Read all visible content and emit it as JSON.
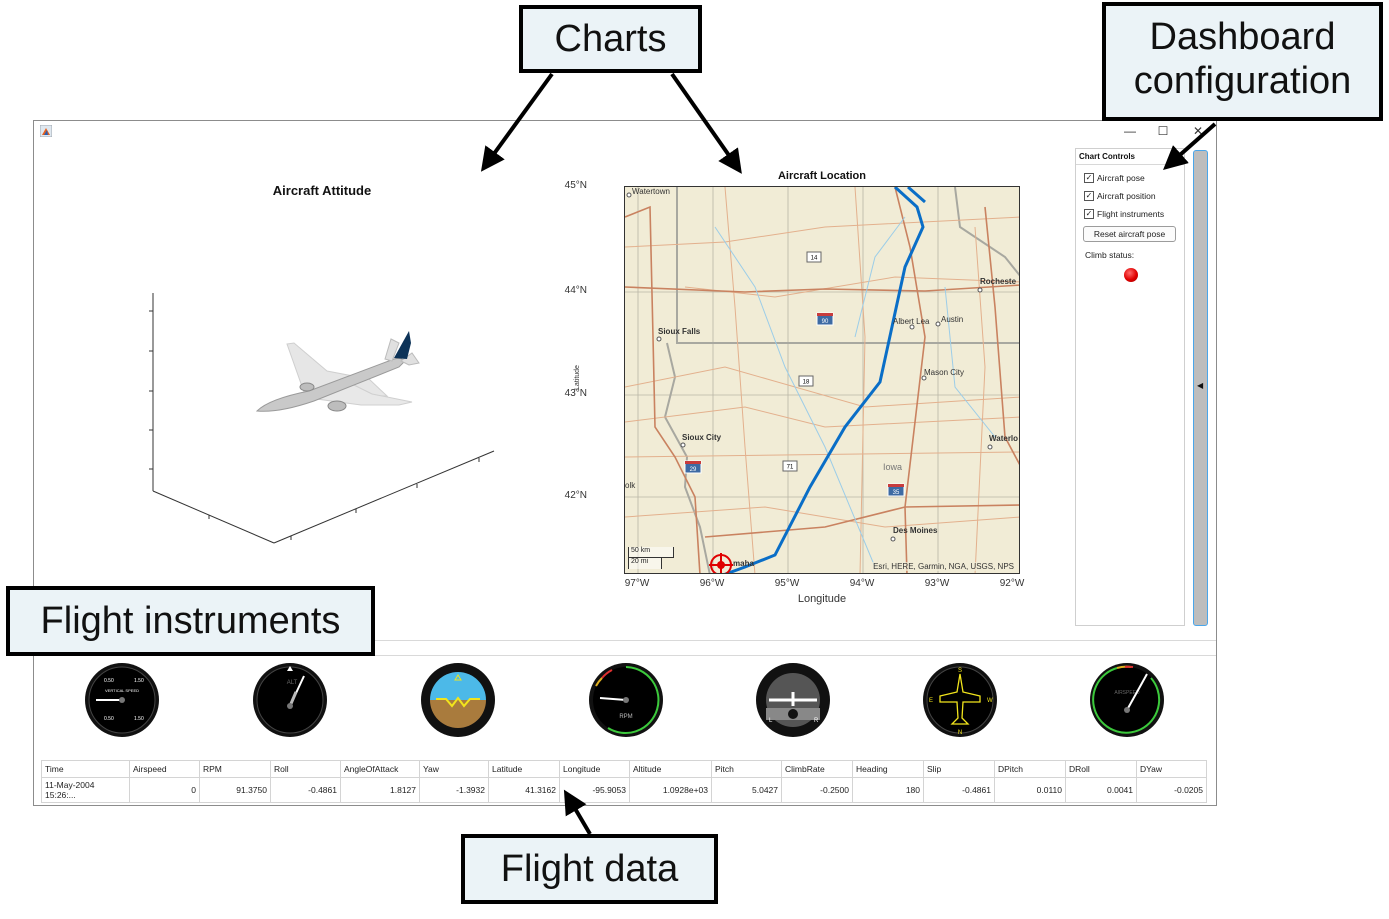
{
  "window": {
    "minimize_glyph": "—",
    "maximize_glyph": "☐",
    "close_glyph": "✕"
  },
  "attitude_chart": {
    "title": "Aircraft Attitude",
    "tail_color": "#0d3358",
    "body_color": "#d8d8d8"
  },
  "map_chart": {
    "title": "Aircraft Location",
    "xlabel": "Longitude",
    "ylabel": "Latitude",
    "lat_ticks": [
      "45°N",
      "44°N",
      "43°N",
      "42°N"
    ],
    "lon_ticks": [
      "97°W",
      "96°W",
      "95°W",
      "94°W",
      "93°W",
      "92°W"
    ],
    "attribution": "Esri, HERE, Garmin, NGA, USGS, NPS",
    "scale_km": "50 km",
    "scale_mi": "20 mi",
    "cities": [
      {
        "name": "Watertown",
        "bold": false
      },
      {
        "name": "Sioux Falls",
        "bold": true
      },
      {
        "name": "Sioux City",
        "bold": true
      },
      {
        "name": "Albert Lea",
        "bold": false
      },
      {
        "name": "Austin",
        "bold": false
      },
      {
        "name": "Rocheste",
        "bold": true
      },
      {
        "name": "Mason City",
        "bold": false
      },
      {
        "name": "Waterlo",
        "bold": true
      },
      {
        "name": "Iowa",
        "bold": false
      },
      {
        "name": "Des Moines",
        "bold": true
      },
      {
        "name": "maha",
        "bold": true
      },
      {
        "name": "olk",
        "bold": false
      }
    ],
    "route_shields": [
      "14",
      "90",
      "18",
      "71",
      "29",
      "35"
    ],
    "track_color": "#0a6ec7",
    "marker_color": "#e00000",
    "current_position": {
      "lat": 41.3162,
      "lon": -95.9053
    }
  },
  "chart_controls": {
    "title": "Chart Controls",
    "checkboxes": [
      {
        "label": "Aircraft pose",
        "checked": true
      },
      {
        "label": "Aircraft position",
        "checked": true
      },
      {
        "label": "Flight instruments",
        "checked": true
      }
    ],
    "reset_button": "Reset aircraft pose",
    "climb_status_label": "Climb status:",
    "climb_status_color": "#e00000",
    "collapse_glyph": "◀"
  },
  "instruments": [
    {
      "name": "Vertical speed indicator",
      "label": "VERTICAL SPEED"
    },
    {
      "name": "Altimeter",
      "label": "ALT"
    },
    {
      "name": "Artificial horizon",
      "label": ""
    },
    {
      "name": "Engine RPM",
      "label": "RPM"
    },
    {
      "name": "Turn coordinator",
      "label": ""
    },
    {
      "name": "Heading indicator",
      "label": ""
    },
    {
      "name": "Airspeed indicator",
      "label": "AIRSPEED"
    }
  ],
  "flight_data": {
    "columns": [
      "Time",
      "Airspeed",
      "RPM",
      "Roll",
      "AngleOfAttack",
      "Yaw",
      "Latitude",
      "Longitude",
      "Altitude",
      "Pitch",
      "ClimbRate",
      "Heading",
      "Slip",
      "DPitch",
      "DRoll",
      "DYaw"
    ],
    "rows": [
      [
        "11-May-2004 15:26:...",
        "0",
        "91.3750",
        "-0.4861",
        "1.8127",
        "-1.3932",
        "41.3162",
        "-95.9053",
        "1.0928e+03",
        "5.0427",
        "-0.2500",
        "180",
        "-0.4861",
        "0.0110",
        "0.0041",
        "-0.0205"
      ]
    ]
  },
  "callouts": {
    "charts": "Charts",
    "dashboard": "Dashboard configuration",
    "instruments": "Flight instruments",
    "data": "Flight data"
  }
}
